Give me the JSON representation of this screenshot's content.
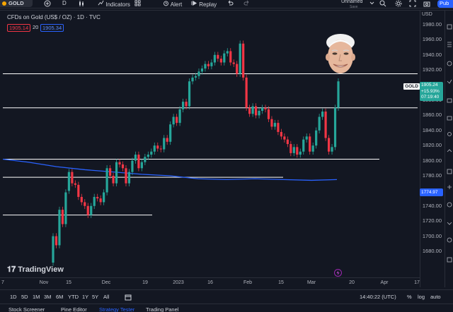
{
  "topbar": {
    "symbol": "GOLD",
    "add_symbol": "+",
    "interval": "D",
    "indicators_label": "Indicators",
    "alert_label": "Alert",
    "replay_label": "Replay",
    "layout_name": "Unnamed",
    "layout_status": "Save",
    "publish_label": "Pub"
  },
  "legend": {
    "title": "CFDs on Gold (US$ / OZ) · 1D · TVC",
    "price_red": "1905.14",
    "spread": "20",
    "price_blue": "1905.34"
  },
  "price_axis": {
    "currency": "USD",
    "ticks": [
      "1980.00",
      "1960.00",
      "1940.00",
      "1920.00",
      "1900.00",
      "1880.00",
      "1860.00",
      "1840.00",
      "1820.00",
      "1800.00",
      "1780.00",
      "1760.00",
      "1740.00",
      "1720.00",
      "1700.00",
      "1680.00"
    ],
    "symbol_label": "GOLD",
    "last_price": "1905.24",
    "change": "+15.93%",
    "countdown": "07:19:40",
    "ma_value": "1774.97"
  },
  "time_axis": {
    "ticks": [
      "7",
      "Nov",
      "15",
      "Dec",
      "19",
      "2023",
      "16",
      "Feb",
      "15",
      "Mar",
      "20",
      "Apr",
      "17"
    ]
  },
  "bottombar": {
    "timeframes": [
      "1D",
      "5D",
      "1M",
      "3M",
      "6M",
      "YTD",
      "1Y",
      "5Y",
      "All"
    ],
    "clock": "14:40:22 (UTC)",
    "percent": "%",
    "log": "log",
    "auto": "auto"
  },
  "panels": [
    "Stock Screener",
    "Pine Editor",
    "Strategy Tester",
    "Trading Panel"
  ],
  "branding": {
    "logo_text": "TradingView"
  },
  "colors": {
    "up": "#26a69a",
    "down": "#f23645",
    "ma": "#2962ff",
    "level": "#ffffff",
    "bg": "#131722"
  },
  "chart_data": {
    "type": "candlestick",
    "title": "CFDs on Gold (US$ / OZ) · 1D · TVC",
    "ylim": [
      1670,
      1995
    ],
    "horizontal_levels": [
      1915,
      1870,
      1802,
      1778,
      1728
    ],
    "moving_average_last": 1774.97,
    "candles": [
      [
        1665,
        1700
      ],
      [
        1700,
        1688
      ],
      [
        1688,
        1735
      ],
      [
        1735,
        1716
      ],
      [
        1716,
        1758
      ],
      [
        1760,
        1785
      ],
      [
        1785,
        1770
      ],
      [
        1770,
        1768
      ],
      [
        1768,
        1752
      ],
      [
        1752,
        1745
      ],
      [
        1745,
        1740
      ],
      [
        1740,
        1728
      ],
      [
        1728,
        1740
      ],
      [
        1740,
        1752
      ],
      [
        1752,
        1750
      ],
      [
        1750,
        1745
      ],
      [
        1745,
        1758
      ],
      [
        1758,
        1790
      ],
      [
        1790,
        1780
      ],
      [
        1780,
        1770
      ],
      [
        1770,
        1798
      ],
      [
        1798,
        1795
      ],
      [
        1795,
        1790
      ],
      [
        1790,
        1770
      ],
      [
        1770,
        1785
      ],
      [
        1785,
        1800
      ],
      [
        1800,
        1808
      ],
      [
        1808,
        1790
      ],
      [
        1790,
        1798
      ],
      [
        1798,
        1805
      ],
      [
        1805,
        1808
      ],
      [
        1808,
        1812
      ],
      [
        1812,
        1820
      ],
      [
        1820,
        1816
      ],
      [
        1816,
        1815
      ],
      [
        1815,
        1830
      ],
      [
        1830,
        1825
      ],
      [
        1825,
        1848
      ],
      [
        1848,
        1858
      ],
      [
        1858,
        1850
      ],
      [
        1850,
        1868
      ],
      [
        1868,
        1878
      ],
      [
        1878,
        1872
      ],
      [
        1872,
        1905
      ],
      [
        1905,
        1910
      ],
      [
        1910,
        1912
      ],
      [
        1912,
        1918
      ],
      [
        1918,
        1922
      ],
      [
        1922,
        1928
      ],
      [
        1928,
        1925
      ],
      [
        1925,
        1930
      ],
      [
        1930,
        1940
      ],
      [
        1940,
        1935
      ],
      [
        1935,
        1930
      ],
      [
        1930,
        1942
      ],
      [
        1942,
        1945
      ],
      [
        1945,
        1930
      ],
      [
        1930,
        1928
      ],
      [
        1928,
        1915
      ],
      [
        1915,
        1955
      ],
      [
        1955,
        1910
      ],
      [
        1910,
        1870
      ],
      [
        1870,
        1862
      ],
      [
        1862,
        1872
      ],
      [
        1872,
        1860
      ],
      [
        1860,
        1866
      ],
      [
        1866,
        1870
      ],
      [
        1870,
        1868
      ],
      [
        1868,
        1855
      ],
      [
        1855,
        1845
      ],
      [
        1845,
        1850
      ],
      [
        1850,
        1838
      ],
      [
        1838,
        1832
      ],
      [
        1832,
        1828
      ],
      [
        1828,
        1822
      ],
      [
        1822,
        1810
      ],
      [
        1810,
        1818
      ],
      [
        1818,
        1808
      ],
      [
        1808,
        1812
      ],
      [
        1812,
        1828
      ],
      [
        1828,
        1832
      ],
      [
        1832,
        1812
      ],
      [
        1812,
        1820
      ],
      [
        1820,
        1840
      ],
      [
        1840,
        1858
      ],
      [
        1858,
        1865
      ],
      [
        1865,
        1830
      ],
      [
        1830,
        1812
      ],
      [
        1812,
        1818
      ],
      [
        1818,
        1870
      ],
      [
        1870,
        1905
      ]
    ]
  }
}
